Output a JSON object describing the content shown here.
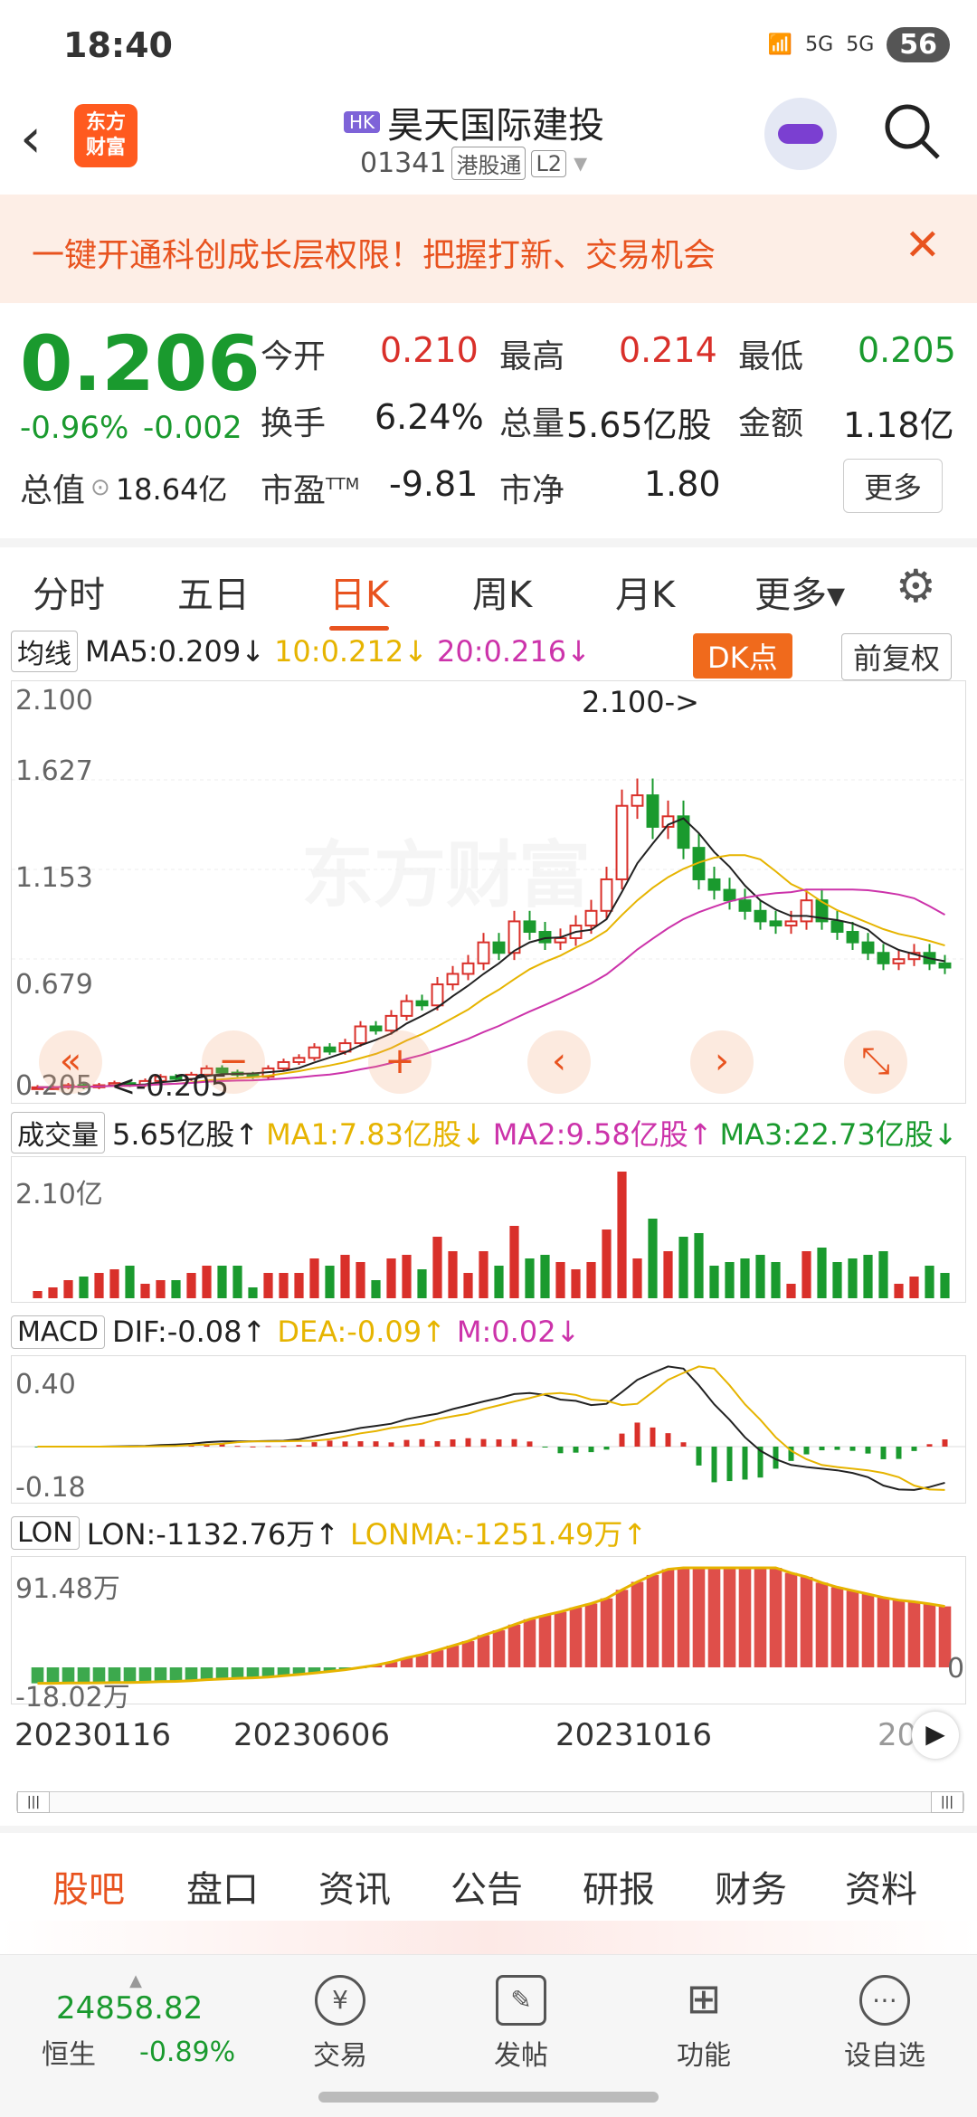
{
  "status_bar": {
    "time": "18:40",
    "signal1": "5G",
    "signal2": "5G",
    "battery": "56"
  },
  "header": {
    "logo_line1": "东方",
    "logo_line2": "财富",
    "market_badge": "HK",
    "stock_name": "昊天国际建投",
    "stock_code": "01341",
    "connect_label": "港股通",
    "level_label": "L2"
  },
  "banner": {
    "text": "一键开通科创成长层权限！把握打新、交易机会",
    "close": "✕"
  },
  "quote": {
    "price": "0.206",
    "change_pct": "-0.96%",
    "change_abs": "-0.002",
    "open_label": "今开",
    "open": "0.210",
    "high_label": "最高",
    "high": "0.214",
    "low_label": "最低",
    "low": "0.205",
    "turnover_label": "换手",
    "turnover": "6.24%",
    "volume_label": "总量",
    "volume": "5.65亿股",
    "amount_label": "金额",
    "amount": "1.18亿",
    "mktcap_label": "总值",
    "mktcap": "18.64亿",
    "pe_label": "市盈",
    "pe_sup": "TTM",
    "pe": "-9.81",
    "pb_label": "市净",
    "pb": "1.80",
    "more_button": "更多"
  },
  "chart_tabs": [
    "分时",
    "五日",
    "日K",
    "周K",
    "月K",
    "更多▾"
  ],
  "chart_tabs_active": "日K",
  "ma_row": {
    "selector": "均线",
    "ma5": "MA5:0.209↓",
    "ma10": "10:0.212↓",
    "ma20": "20:0.216↓",
    "dk_button": "DK点",
    "fuquan_button": "前复权"
  },
  "kline_axis": {
    "y_labels": [
      "2.100",
      "1.627",
      "1.153",
      "0.679",
      "0.205"
    ],
    "max_marker": "2.100->",
    "min_marker": "<-0.205",
    "watermark": "东方财富"
  },
  "volume_row": {
    "selector": "成交量",
    "vol": "5.65亿股↑",
    "ma1": "MA1:7.83亿股↓",
    "ma2": "MA2:9.58亿股↑",
    "ma3": "MA3:22.73亿股↓",
    "y_max": "2.10亿"
  },
  "macd_row": {
    "selector": "MACD",
    "dif": "DIF:-0.08↑",
    "dea": "DEA:-0.09↑",
    "m": "M:0.02↓",
    "y_max": "0.40",
    "y_min": "-0.18"
  },
  "lon_row": {
    "selector": "LON",
    "lon": "LON:-1132.76万↑",
    "lonma": "LONMA:-1251.49万↑",
    "y_max": "91.48万",
    "y_min": "-18.02万",
    "zero": "0"
  },
  "x_axis": [
    "20230116",
    "20230606",
    "20231016",
    "20"
  ],
  "bottom_tabs": [
    "股吧",
    "盘口",
    "资讯",
    "公告",
    "研报",
    "财务",
    "资料"
  ],
  "bottom_tabs_active": "股吧",
  "bottom_nav": {
    "index_value": "24858.82",
    "index_name": "恒生",
    "index_change": "-0.89%",
    "items": [
      "交易",
      "发帖",
      "功能",
      "设自选"
    ]
  },
  "colors": {
    "accent": "#e8531f",
    "up": "#d9302a",
    "down": "#1a9a2e",
    "ma5": "#222222",
    "ma10": "#e6b400",
    "ma20": "#cc33aa"
  },
  "chart_data": {
    "type": "candlestick",
    "title": "",
    "ylim": [
      0.205,
      2.1
    ],
    "x_ticks": [
      "20230116",
      "20230606",
      "20231016"
    ],
    "close_series": [
      0.21,
      0.21,
      0.22,
      0.21,
      0.22,
      0.23,
      0.22,
      0.24,
      0.26,
      0.25,
      0.27,
      0.3,
      0.28,
      0.27,
      0.26,
      0.3,
      0.33,
      0.35,
      0.4,
      0.38,
      0.42,
      0.5,
      0.48,
      0.55,
      0.62,
      0.6,
      0.7,
      0.75,
      0.8,
      0.9,
      0.85,
      1.0,
      0.95,
      0.9,
      0.92,
      0.98,
      1.05,
      1.2,
      1.55,
      1.6,
      1.45,
      1.5,
      1.35,
      1.2,
      1.15,
      1.1,
      1.05,
      1.0,
      0.98,
      1.0,
      1.1,
      1.0,
      0.95,
      0.9,
      0.85,
      0.8,
      0.82,
      0.85,
      0.8,
      0.78
    ],
    "max_price": 2.1,
    "min_price": 0.205
  }
}
